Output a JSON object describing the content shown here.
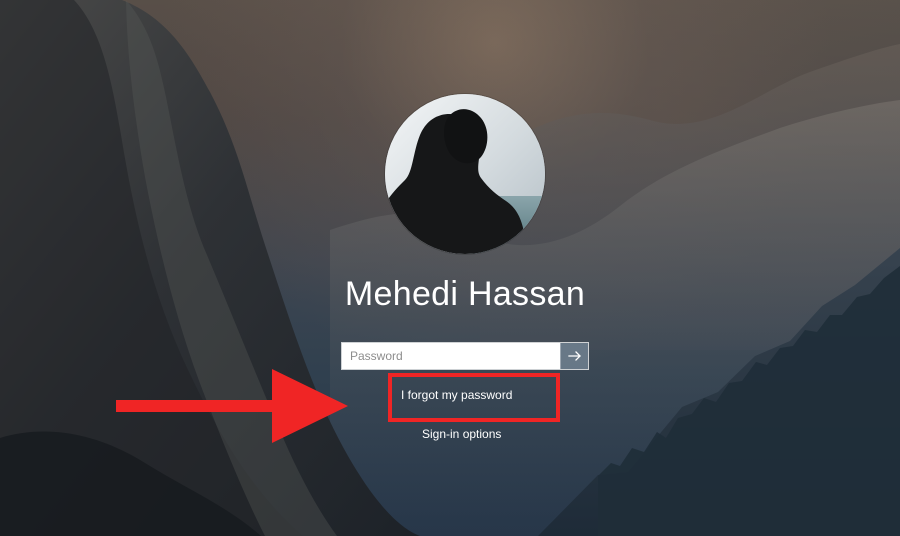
{
  "login": {
    "user_name": "Mehedi Hassan",
    "password_placeholder": "Password",
    "forgot_password": "I forgot my password",
    "sign_in_options": "Sign-in options"
  },
  "icons": {
    "submit": "arrow-right-icon",
    "avatar": "user-avatar",
    "annotation_arrow": "red-arrow-icon"
  },
  "colors": {
    "annotation": "#f02525",
    "text": "#ffffff",
    "submit_background": "#798b9b"
  }
}
